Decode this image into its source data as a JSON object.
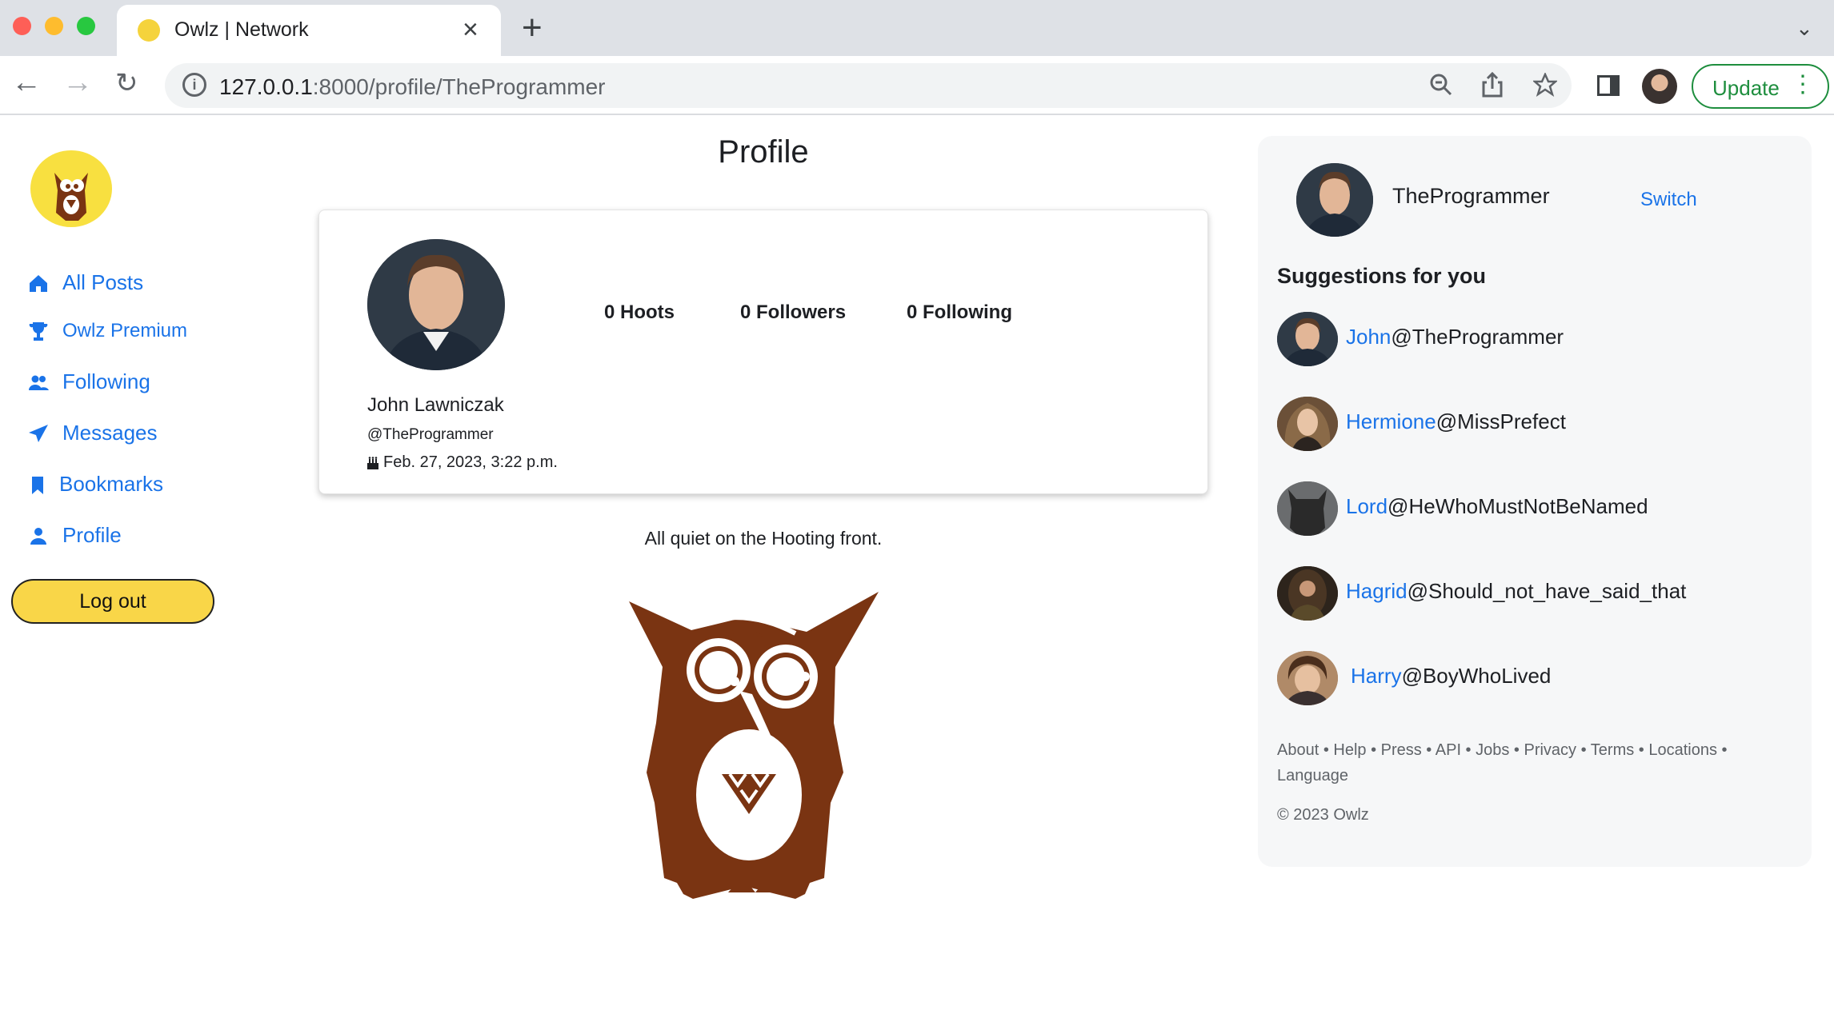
{
  "browser": {
    "tab_title": "Owlz | Network",
    "url_host": "127.0.0.1",
    "url_path": ":8000/profile/TheProgrammer",
    "update_label": "Update"
  },
  "sidebar": {
    "items": [
      {
        "label": "All Posts",
        "icon": "home-icon"
      },
      {
        "label": "Owlz Premium",
        "icon": "trophy-icon"
      },
      {
        "label": "Following",
        "icon": "people-icon"
      },
      {
        "label": "Messages",
        "icon": "send-icon"
      },
      {
        "label": "Bookmarks",
        "icon": "bookmark-icon"
      },
      {
        "label": "Profile",
        "icon": "person-icon"
      }
    ],
    "logout_label": "Log out"
  },
  "main": {
    "title": "Profile",
    "stats": {
      "hoots": "0 Hoots",
      "followers": "0 Followers",
      "following": "0 Following"
    },
    "full_name": "John Lawniczak",
    "handle": "@TheProgrammer",
    "joined": "Feb. 27, 2023, 3:22 p.m.",
    "empty_message": "All quiet on the Hooting front."
  },
  "right_panel": {
    "current_user": "TheProgrammer",
    "switch_label": "Switch",
    "suggestions_title": "Suggestions for you",
    "suggestions": [
      {
        "first": "John",
        "handle": "@TheProgrammer"
      },
      {
        "first": "Hermione",
        "handle": "@MissPrefect"
      },
      {
        "first": "Lord",
        "handle": "@HeWhoMustNotBeNamed"
      },
      {
        "first": "Hagrid",
        "handle": "@Should_not_have_said_that"
      },
      {
        "first": "Harry",
        "handle": "@BoyWhoLived"
      }
    ],
    "footer_links": "About • Help • Press • API • Jobs • Privacy • Terms • Locations • Language",
    "copyright": "© 2023 Owlz"
  },
  "colors": {
    "link": "#1a73e8",
    "logout_bg": "#f9d648",
    "owl_brown": "#7a3412",
    "logo_yellow": "#f8e040"
  }
}
